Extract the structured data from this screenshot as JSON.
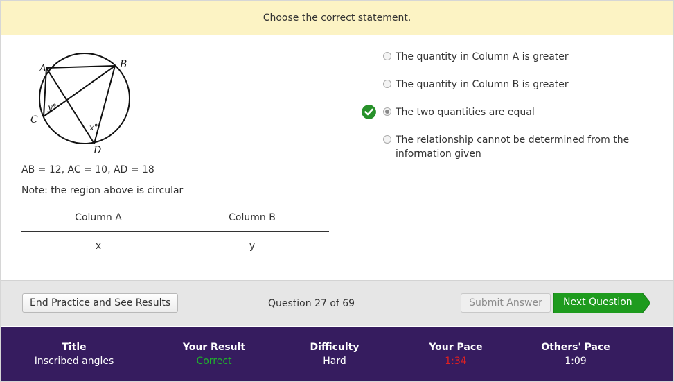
{
  "instruction": "Choose the correct statement.",
  "figure": {
    "point_labels": {
      "A": "A",
      "B": "B",
      "C": "C",
      "D": "D"
    },
    "angle_labels": {
      "y": "y°",
      "x": "x°"
    }
  },
  "question": {
    "given": "AB = 12, AC = 10, AD = 18",
    "note": "Note: the region above is circular",
    "column_a_header": "Column A",
    "column_b_header": "Column B",
    "column_a_value": "x",
    "column_b_value": "y"
  },
  "options": [
    {
      "label": "The quantity in Column A is greater",
      "selected": false
    },
    {
      "label": "The quantity in Column B is greater",
      "selected": false
    },
    {
      "label": "The two quantities are equal",
      "selected": true,
      "correct": true
    },
    {
      "label": "The relationship cannot be determined from the information given",
      "selected": false
    }
  ],
  "footer": {
    "end_button": "End Practice and See Results",
    "counter": "Question 27 of 69",
    "submit_button": "Submit Answer",
    "next_button": "Next Question"
  },
  "stats": {
    "title_label": "Title",
    "title_value": "Inscribed angles",
    "result_label": "Your Result",
    "result_value": "Correct",
    "difficulty_label": "Difficulty",
    "difficulty_value": "Hard",
    "pace_label": "Your Pace",
    "pace_value": "1:34",
    "others_label": "Others' Pace",
    "others_value": "1:09"
  },
  "colors": {
    "instruction_bg": "#fcf3c4",
    "next_button": "#1e9b1e",
    "stats_bg": "#361c5f",
    "correct": "#1fb32b",
    "slow": "#e02020"
  },
  "icons": [
    "checkmark-correct-icon",
    "arrow-right-icon"
  ]
}
